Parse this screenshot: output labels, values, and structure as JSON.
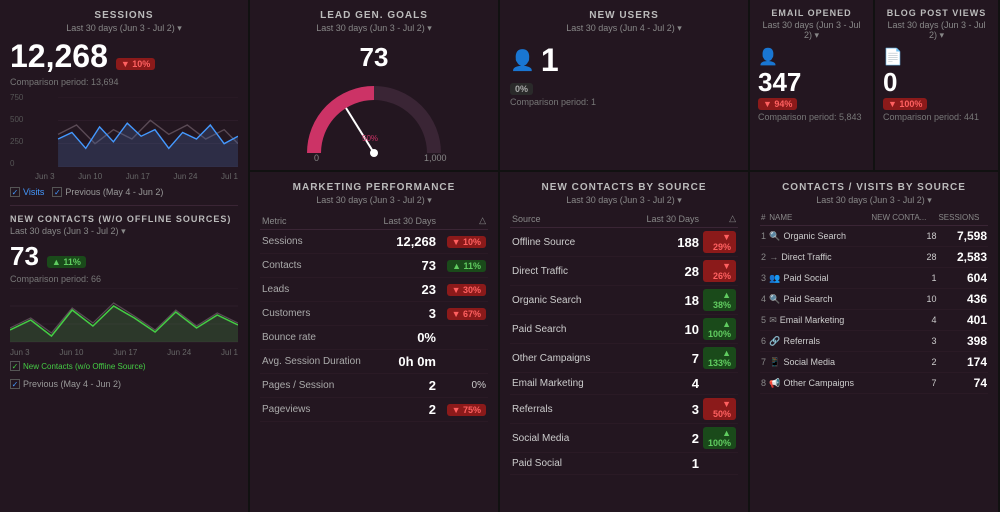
{
  "sessions": {
    "title": "SESSIONS",
    "subtitle": "Last 30 days (Jun 3 - Jul 2)",
    "value": "12,268",
    "badge": "▼ 10%",
    "badge_type": "red",
    "comparison": "Comparison period: 13,694",
    "y_labels": [
      "750",
      "500",
      "250",
      "0"
    ],
    "x_labels": [
      "Jun 3",
      "Jun 10",
      "Jun 17",
      "Jun 24",
      "Jul 1"
    ],
    "legend_visits": "Visits",
    "legend_previous": "Previous (May 4 - Jun 2)"
  },
  "new_contacts_offline": {
    "title": "NEW CONTACTS (W/O OFFLINE SOURCES)",
    "subtitle": "Last 30 days (Jun 3 - Jul 2)",
    "value": "73",
    "badge": "▲ 11%",
    "badge_type": "green",
    "comparison": "Comparison period: 66",
    "x_labels": [
      "Jun 3",
      "Jun 10",
      "Jun 17",
      "Jun 24",
      "Jul 1"
    ],
    "legend_contacts": "New Contacts (w/o Offline Source)",
    "legend_previous": "Previous (May 4 - Jun 2)"
  },
  "lead_gen": {
    "title": "LEAD GEN. GOALS",
    "subtitle": "Last 30 days (Jun 3 - Jul 2)",
    "value": "73",
    "goal_label": "50%",
    "min": "0",
    "max": "1,000"
  },
  "new_users": {
    "title": "NEW USERS",
    "subtitle": "Last 30 days (Jun 4 - Jul 2)",
    "value": "1",
    "badge": "0%",
    "badge_type": "neutral",
    "comparison": "Comparison period: 1"
  },
  "email_opened": {
    "title": "EMAIL OPENED",
    "subtitle": "Last 30 days (Jun 3 - Jul 2)",
    "value": "347",
    "badge": "▼ 94%",
    "badge_type": "red",
    "comparison": "Comparison period: 5,843"
  },
  "blog_post_views": {
    "title": "BLOG POST VIEWS",
    "subtitle": "Last 30 days (Jun 3 - Jul 2)",
    "value": "0",
    "badge": "▼ 100%",
    "badge_type": "red",
    "comparison": "Comparison period: 441"
  },
  "marketing_performance": {
    "title": "MARKETING PERFORMANCE",
    "subtitle": "Last 30 days (Jun 3 - Jul 2)",
    "col_metric": "Metric",
    "col_last30": "Last 30 Days",
    "col_delta": "△",
    "rows": [
      {
        "metric": "Sessions",
        "value": "12,268",
        "delta": "▼ 10%",
        "delta_type": "red"
      },
      {
        "metric": "Contacts",
        "value": "73",
        "delta": "▲ 11%",
        "delta_type": "green"
      },
      {
        "metric": "Leads",
        "value": "23",
        "delta": "▼ 30%",
        "delta_type": "red"
      },
      {
        "metric": "Customers",
        "value": "3",
        "delta": "▼ 67%",
        "delta_type": "red"
      },
      {
        "metric": "Bounce rate",
        "value": "0%",
        "delta": "",
        "delta_type": "neutral"
      },
      {
        "metric": "Avg. Session Duration",
        "value": "0h 0m",
        "delta": "",
        "delta_type": "neutral"
      },
      {
        "metric": "Pages / Session",
        "value": "2",
        "delta": "0%",
        "delta_type": "neutral"
      },
      {
        "metric": "Pageviews",
        "value": "2",
        "delta": "▼ 75%",
        "delta_type": "red"
      }
    ]
  },
  "new_contacts_source": {
    "title": "NEW CONTACTS BY SOURCE",
    "subtitle": "Last 30 days (Jun 3 - Jul 2)",
    "col_source": "Source",
    "col_last30": "Last 30 Days",
    "col_delta": "△",
    "rows": [
      {
        "source": "Offline Source",
        "value": "188",
        "delta": "▼ 29%",
        "delta_type": "red"
      },
      {
        "source": "Direct Traffic",
        "value": "28",
        "delta": "▼ 26%",
        "delta_type": "red"
      },
      {
        "source": "Organic Search",
        "value": "18",
        "delta": "▲ 38%",
        "delta_type": "green"
      },
      {
        "source": "Paid Search",
        "value": "10",
        "delta": "▲ 100%",
        "delta_type": "green"
      },
      {
        "source": "Other Campaigns",
        "value": "7",
        "delta": "▲ 133%",
        "delta_type": "green"
      },
      {
        "source": "Email Marketing",
        "value": "4",
        "delta": "",
        "delta_type": "neutral"
      },
      {
        "source": "Referrals",
        "value": "3",
        "delta": "▼ 50%",
        "delta_type": "red"
      },
      {
        "source": "Social Media",
        "value": "2",
        "delta": "▲ 100%",
        "delta_type": "green"
      },
      {
        "source": "Paid Social",
        "value": "1",
        "delta": "",
        "delta_type": "neutral"
      }
    ]
  },
  "contacts_visits": {
    "title": "CONTACTS / VISITS BY SOURCE",
    "subtitle": "Last 30 days (Jun 3 - Jul 2)",
    "col_num": "#",
    "col_name": "NAME",
    "col_contacts": "NEW CONTA...",
    "col_sessions": "SESSIONS",
    "rows": [
      {
        "rank": "1",
        "icon": "🔍",
        "name": "Organic Search",
        "contacts": "18",
        "sessions": "7,598"
      },
      {
        "rank": "2",
        "icon": "→",
        "name": "Direct Traffic",
        "contacts": "28",
        "sessions": "2,583"
      },
      {
        "rank": "3",
        "icon": "👥",
        "name": "Paid Social",
        "contacts": "1",
        "sessions": "604"
      },
      {
        "rank": "4",
        "icon": "🔍",
        "name": "Paid Search",
        "contacts": "10",
        "sessions": "436"
      },
      {
        "rank": "5",
        "icon": "✉",
        "name": "Email Marketing",
        "contacts": "4",
        "sessions": "401"
      },
      {
        "rank": "6",
        "icon": "🔗",
        "name": "Referrals",
        "contacts": "3",
        "sessions": "398"
      },
      {
        "rank": "7",
        "icon": "📱",
        "name": "Social Media",
        "contacts": "2",
        "sessions": "174"
      },
      {
        "rank": "8",
        "icon": "📢",
        "name": "Other Campaigns",
        "contacts": "7",
        "sessions": "74"
      }
    ]
  }
}
